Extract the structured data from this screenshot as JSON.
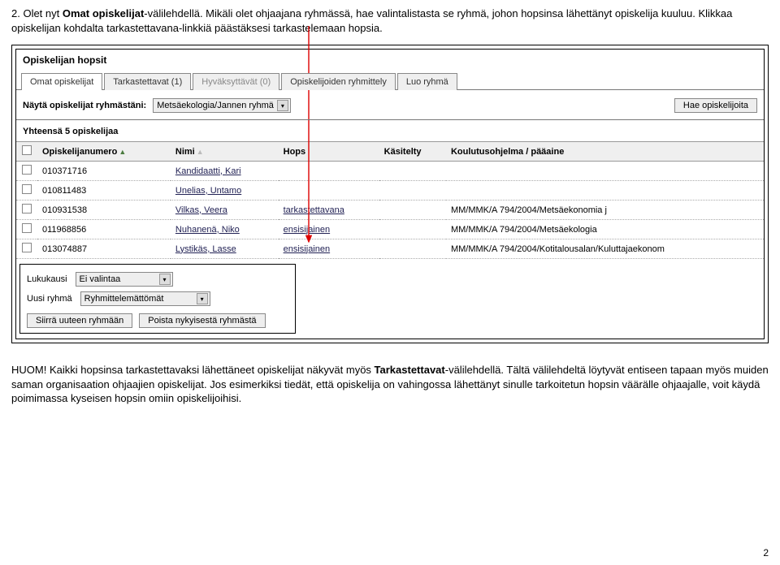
{
  "intro": {
    "p1_prefix": "2. Olet nyt ",
    "p1_bold": "Omat opiskelijat",
    "p1_suffix": "-välilehdellä. Mikäli olet ohjaajana ryhmässä, hae valintalistasta se ryhmä, johon hopsinsa lähettänyt opiskelija kuuluu. Klikkaa opiskelijan kohdalta tarkastettavana-linkkiä päästäksesi tarkastelemaan hopsia."
  },
  "app": {
    "title": "Opiskelijan hopsit",
    "tabs": {
      "0": "Omat opiskelijat",
      "1": "Tarkastettavat (1)",
      "2": "Hyväksyttävät (0)",
      "3": "Opiskelijoiden ryhmittely",
      "4": "Luo ryhmä"
    },
    "filter": {
      "label": "Näytä opiskelijat ryhmästäni:",
      "selected": "Metsäekologia/Jannen ryhmä",
      "hae": "Hae opiskelijoita"
    },
    "count": "Yhteensä 5 opiskelijaa",
    "headers": {
      "num": "Opiskelijanumero",
      "name": "Nimi",
      "hops": "Hops",
      "handled": "Käsitelty",
      "prog": "Koulutusohjelma / pääaine"
    },
    "rows": [
      {
        "num": "010371716",
        "name": "Kandidaatti, Kari",
        "hops": "",
        "prog": ""
      },
      {
        "num": "010811483",
        "name": "Unelias, Untamo",
        "hops": "",
        "prog": ""
      },
      {
        "num": "010931538",
        "name": "Vilkas, Veera",
        "hops": "tarkastettavana",
        "prog": "MM/MMK/A 794/2004/Metsäekonomia j"
      },
      {
        "num": "011968856",
        "name": "Nuhanenä, Niko",
        "hops": "ensisijainen",
        "prog": "MM/MMK/A 794/2004/Metsäekologia"
      },
      {
        "num": "013074887",
        "name": "Lystikäs, Lasse",
        "hops": "ensisijainen",
        "prog": "MM/MMK/A 794/2004/Kotitalousalan/Kuluttajaekonom"
      }
    ],
    "bottom": {
      "lukukausi_label": "Lukukausi",
      "lukukausi_val": "Ei valintaa",
      "uusiryhma_label": "Uusi ryhmä",
      "uusiryhma_val": "Ryhmittelemättömät",
      "btn_move": "Siirrä uuteen ryhmään",
      "btn_remove": "Poista nykyisestä ryhmästä"
    }
  },
  "note": {
    "p_prefix": "HUOM! Kaikki hopsinsa tarkastettavaksi lähettäneet opiskelijat näkyvät myös ",
    "p_bold": "Tarkastettavat",
    "p_suffix": "-välilehdellä. Tältä välilehdeltä löytyvät entiseen tapaan myös muiden saman organisaation ohjaajien opiskelijat. Jos esimerkiksi tiedät, että opiskelija on vahingossa lähettänyt sinulle tarkoitetun hopsin väärälle ohjaajalle, voit käydä poimimassa kyseisen hopsin omiin opiskelijoihisi."
  },
  "pagenum": "2"
}
